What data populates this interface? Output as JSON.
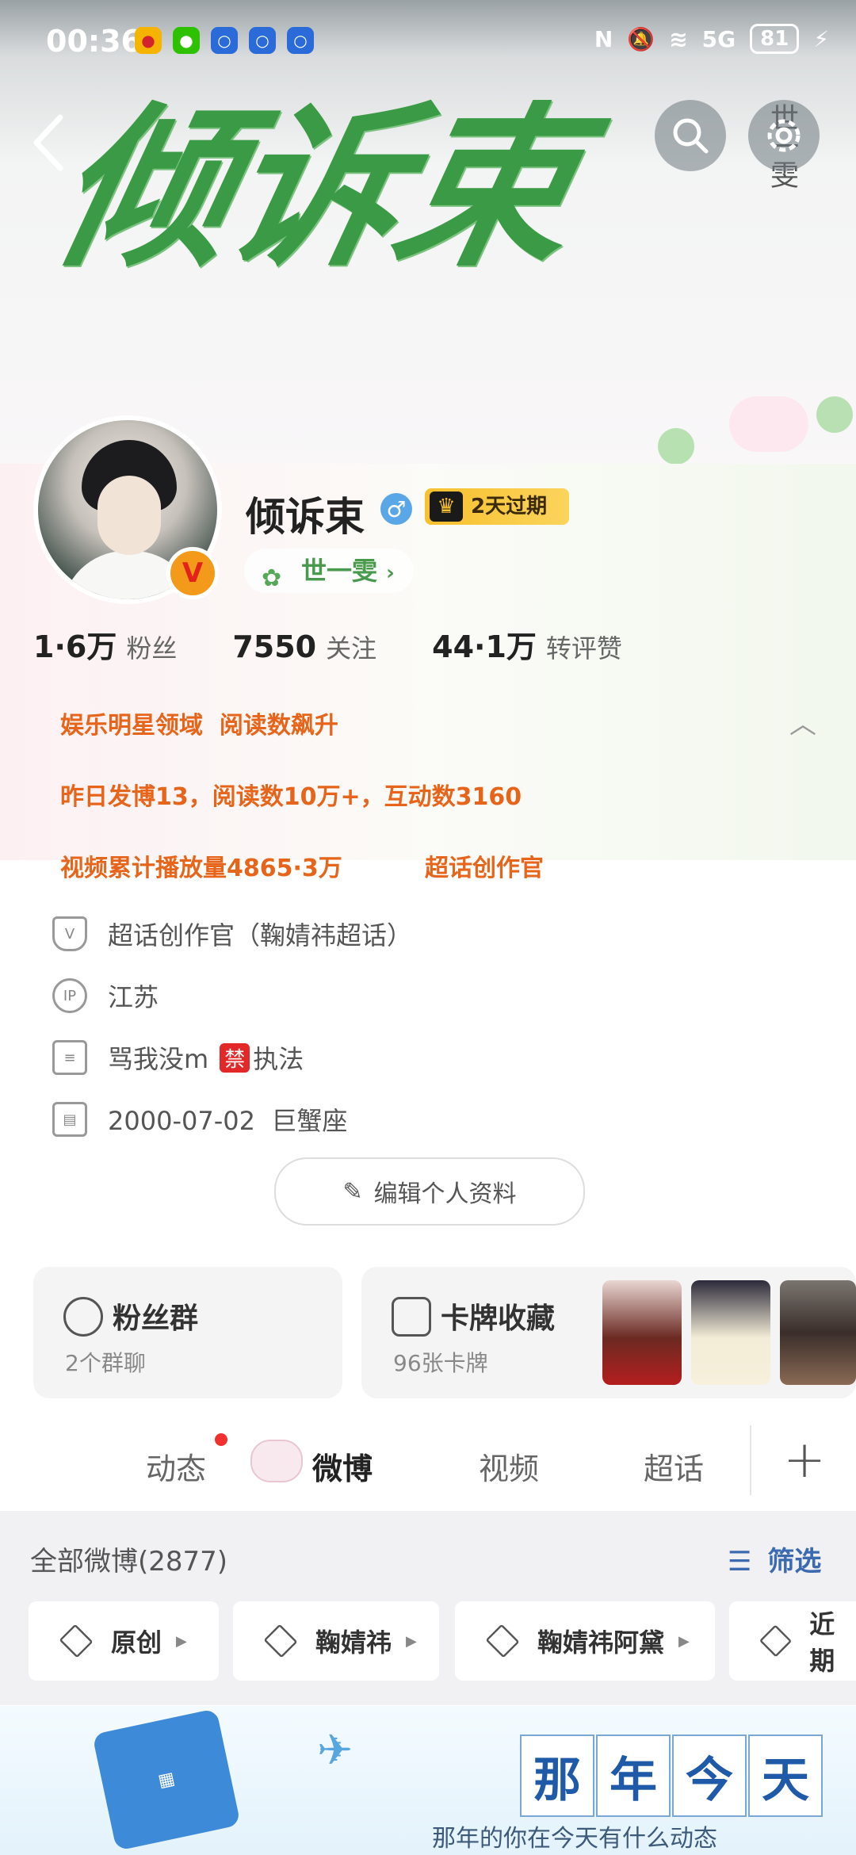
{
  "status_bar": {
    "time": "00:36",
    "network": "5G",
    "battery": "81"
  },
  "banner": {
    "title": "倾诉束",
    "side_text": "世一雯"
  },
  "profile": {
    "name": "倾诉束",
    "gender_icon": "♂",
    "vip_text": "2天过期",
    "verified_badge": "V",
    "tag": "世一雯",
    "stats": [
      {
        "num": "1·6万",
        "label": "粉丝"
      },
      {
        "num": "7550",
        "label": "关注"
      },
      {
        "num": "44·1万",
        "label": "转评赞"
      }
    ],
    "highlights": {
      "line1": "娱乐明星领域  阅读数飙升",
      "line2": "昨日发博13，阅读数10万+，互动数3160",
      "line3a": "视频累计播放量4865·3万",
      "line3b": "超话创作官"
    },
    "info": {
      "creator": "超话创作官（鞠婧祎超话）",
      "ip": "江苏",
      "bio_prefix": "骂我没m",
      "ban_label": "禁",
      "bio_suffix": "执法",
      "birthday": "2000-07-02  巨蟹座"
    },
    "edit_button": "编辑个人资料"
  },
  "cards": {
    "fans_group": {
      "title": "粉丝群",
      "sub": "2个群聊"
    },
    "card_collection": {
      "title": "卡牌收藏",
      "sub": "96张卡牌"
    }
  },
  "tabs": [
    "动态",
    "微博",
    "视频",
    "超话"
  ],
  "feed": {
    "all_label": "全部微博(2877)",
    "filter_label": "筛选",
    "chips": [
      "原创",
      "鞠婧祎",
      "鞠婧祎阿黛",
      "近期"
    ]
  },
  "ad": {
    "chars": [
      "那",
      "年",
      "今",
      "天"
    ],
    "subtitle": "那年的你在今天有什么动态"
  },
  "colors": {
    "accent_orange": "#e7651a",
    "link_blue": "#3c6ab0",
    "vip_gold": "#f7c02d",
    "banner_green": "#3b9a45"
  }
}
